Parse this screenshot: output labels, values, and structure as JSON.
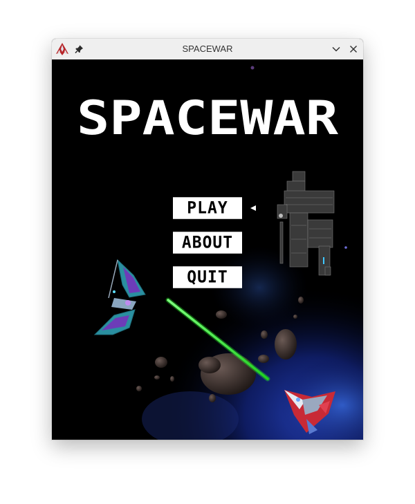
{
  "window": {
    "title": "SPACEWAR",
    "icons": {
      "app": "spaceship-app-icon",
      "pin": "pin-icon",
      "minimize": "chevron-down-icon",
      "close": "close-icon"
    }
  },
  "game": {
    "title": "SPACEWAR",
    "menu": {
      "items": [
        {
          "label": "PLAY",
          "selected": true
        },
        {
          "label": "ABOUT",
          "selected": false
        },
        {
          "label": "QUIT",
          "selected": false
        }
      ],
      "selector_icon": "triangle-left-icon"
    },
    "colors": {
      "background": "#000000",
      "title": "#ffffff",
      "button_bg": "#ffffff",
      "button_text": "#000000",
      "laser": "#4cff4c",
      "nebula": "#1b2f8a"
    }
  }
}
